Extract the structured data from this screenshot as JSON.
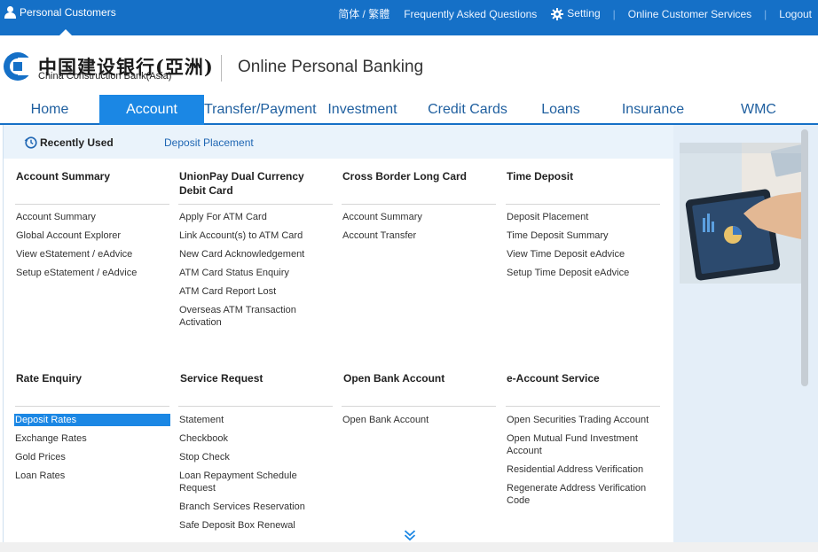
{
  "topbar": {
    "segment_label": "Personal Customers",
    "language_label": "简体 / 繁體",
    "faq_label": "Frequently Asked Questions",
    "setting_label": "Setting",
    "online_service_label": "Online Customer Services",
    "logout_label": "Logout"
  },
  "brand": {
    "name_zh": "中国建设银行(亞洲)",
    "name_en": "China Construction Bank(Asia)",
    "product_title": "Online Personal Banking"
  },
  "nav": {
    "items": [
      "Home",
      "Account",
      "Transfer/Payment",
      "Investment",
      "Credit Cards",
      "Loans",
      "Insurance",
      "WMC"
    ],
    "active": "Account"
  },
  "recently_used": {
    "label": "Recently Used",
    "links": [
      "Deposit Placement"
    ]
  },
  "menu": {
    "sections": [
      {
        "title": "Account Summary",
        "links": [
          "Account Summary",
          "Global Account Explorer",
          "View eStatement / eAdvice",
          "Setup eStatement / eAdvice"
        ]
      },
      {
        "title": "UnionPay Dual Currency Debit Card",
        "links": [
          "Apply For ATM Card",
          "Link Account(s) to ATM Card",
          "New Card Acknowledgement",
          "ATM Card Status Enquiry",
          "ATM Card Report Lost",
          "Overseas ATM Transaction Activation"
        ]
      },
      {
        "title": "Cross Border Long Card",
        "links": [
          "Account Summary",
          "Account Transfer"
        ]
      },
      {
        "title": "Time Deposit",
        "links": [
          "Deposit Placement",
          "Time Deposit Summary",
          "View Time Deposit eAdvice",
          "Setup Time Deposit eAdvice"
        ]
      },
      {
        "title": "Rate Enquiry",
        "links": [
          "Deposit Rates",
          "Exchange Rates",
          "Gold Prices",
          "Loan Rates"
        ]
      },
      {
        "title": "Service Request",
        "links": [
          "Statement",
          "Checkbook",
          "Stop Check",
          "Loan Repayment Schedule Request",
          "Branch Services Reservation",
          "Safe Deposit Box Renewal"
        ]
      },
      {
        "title": "Open Bank Account",
        "links": [
          "Open Bank Account"
        ]
      },
      {
        "title": "e-Account Service",
        "links": [
          "Open Securities Trading Account",
          "Open Mutual Fund Investment Account",
          "Residential Address Verification",
          "Regenerate Address Verification Code"
        ]
      }
    ],
    "highlighted_link": "Deposit Rates"
  },
  "colors": {
    "brand_blue": "#1570c7",
    "active_blue": "#1b87e4",
    "link_blue": "#1f66b3"
  },
  "icons": [
    "person-icon",
    "gear-icon",
    "history-icon",
    "double-chevron-down-icon",
    "bank-logo-mark"
  ]
}
